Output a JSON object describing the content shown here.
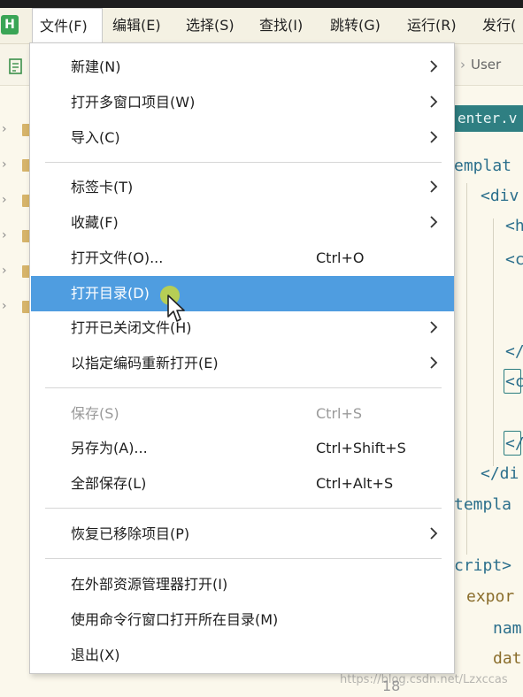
{
  "app": {
    "logo_letter": "H"
  },
  "menubar": {
    "items": [
      "文件(F)",
      "编辑(E)",
      "选择(S)",
      "查找(I)",
      "跳转(G)",
      "运行(R)",
      "发行("
    ]
  },
  "toolbar": {
    "breadcrumb_partial": "User"
  },
  "editor": {
    "tab_label": "enter.v",
    "lines": [
      "emplat",
      "<div",
      "<h",
      "<c",
      "</",
      "<c",
      "</",
      "</di",
      "templa",
      "cript>",
      "expor",
      "nam",
      "dat"
    ]
  },
  "gutter": {
    "line_number": "18"
  },
  "watermark": "https://blog.csdn.net/Lzxccas",
  "menu": {
    "items": [
      {
        "label": "新建(N)",
        "submenu": true
      },
      {
        "label": "打开多窗口项目(W)",
        "submenu": true
      },
      {
        "label": "导入(C)",
        "submenu": true
      },
      {
        "label": "标签卡(T)",
        "submenu": true
      },
      {
        "label": "收藏(F)",
        "submenu": true
      },
      {
        "label": "打开文件(O)...",
        "shortcut": "Ctrl+O"
      },
      {
        "label": "打开目录(D)",
        "highlighted": true
      },
      {
        "label": "打开已关闭文件(H)",
        "submenu": true
      },
      {
        "label": "以指定编码重新打开(E)",
        "submenu": true
      },
      {
        "label": "保存(S)",
        "shortcut": "Ctrl+S",
        "disabled": true
      },
      {
        "label": "另存为(A)...",
        "shortcut": "Ctrl+Shift+S"
      },
      {
        "label": "全部保存(L)",
        "shortcut": "Ctrl+Alt+S"
      },
      {
        "label": "恢复已移除项目(P)",
        "submenu": true
      },
      {
        "label": "在外部资源管理器打开(I)"
      },
      {
        "label": "使用命令行窗口打开所在目录(M)"
      },
      {
        "label": "退出(X)"
      }
    ]
  },
  "colors": {
    "highlight": "#4f9de0",
    "menubar_bg": "#f4f1e3",
    "editor_bg": "#fbf8ec",
    "tab_bg": "#2f7f82"
  }
}
